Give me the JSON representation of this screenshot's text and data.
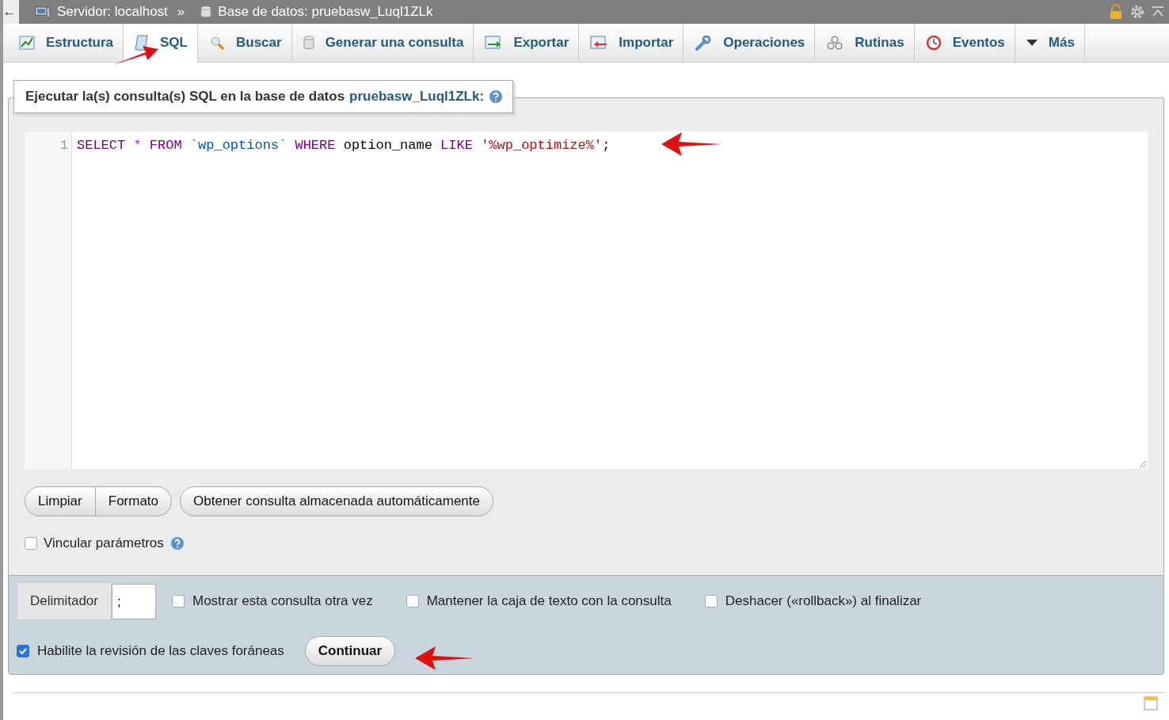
{
  "breadcrumb": {
    "back": "←",
    "server": "Servidor: localhost",
    "separator": "»",
    "database": "Base de datos: pruebasw_Luql1ZLk"
  },
  "tabs": [
    {
      "label": "Estructura",
      "selected": false
    },
    {
      "label": "SQL",
      "selected": true
    },
    {
      "label": "Buscar",
      "selected": false
    },
    {
      "label": "Generar una consulta",
      "selected": false
    },
    {
      "label": "Exportar",
      "selected": false
    },
    {
      "label": "Importar",
      "selected": false
    },
    {
      "label": "Operaciones",
      "selected": false
    },
    {
      "label": "Rutinas",
      "selected": false
    },
    {
      "label": "Eventos",
      "selected": false
    },
    {
      "label": "Más",
      "selected": false
    }
  ],
  "query_panel": {
    "legend": "Ejecutar la(s) consulta(s) SQL en la base de datos",
    "database_link": "pruebasw_Luql1ZLk:",
    "editor": {
      "line_number": "1",
      "tokens": [
        {
          "text": "SELECT",
          "kind": "keyword"
        },
        {
          "text": "*",
          "kind": "operator"
        },
        {
          "text": "FROM",
          "kind": "keyword"
        },
        {
          "text": "`wp_options`",
          "kind": "identifier"
        },
        {
          "text": "WHERE",
          "kind": "keyword"
        },
        {
          "text": "option_name",
          "kind": "plain"
        },
        {
          "text": "LIKE",
          "kind": "keyword"
        },
        {
          "text": "'%wp_optimize%'",
          "kind": "string"
        },
        {
          "text": ";",
          "kind": "punct"
        }
      ]
    },
    "buttons": [
      "Limpiar",
      "Formato"
    ],
    "auto_button": "Obtener consulta almacenada automáticamente",
    "bind_parameters": {
      "label": "Vincular parámetros",
      "checked": false
    }
  },
  "options": {
    "delimiter_label": "Delimitador",
    "delimiter_value": ";",
    "checkboxes": [
      {
        "label": "Mostrar esta consulta otra vez",
        "checked": false
      },
      {
        "label": "Mantener la caja de texto con la consulta",
        "checked": false
      },
      {
        "label": "Deshacer («rollback») al finalizar",
        "checked": false
      }
    ],
    "foreign_keys": {
      "label": "Habilite la revisión de las claves foráneas",
      "checked": true
    },
    "submit": "Continuar"
  }
}
